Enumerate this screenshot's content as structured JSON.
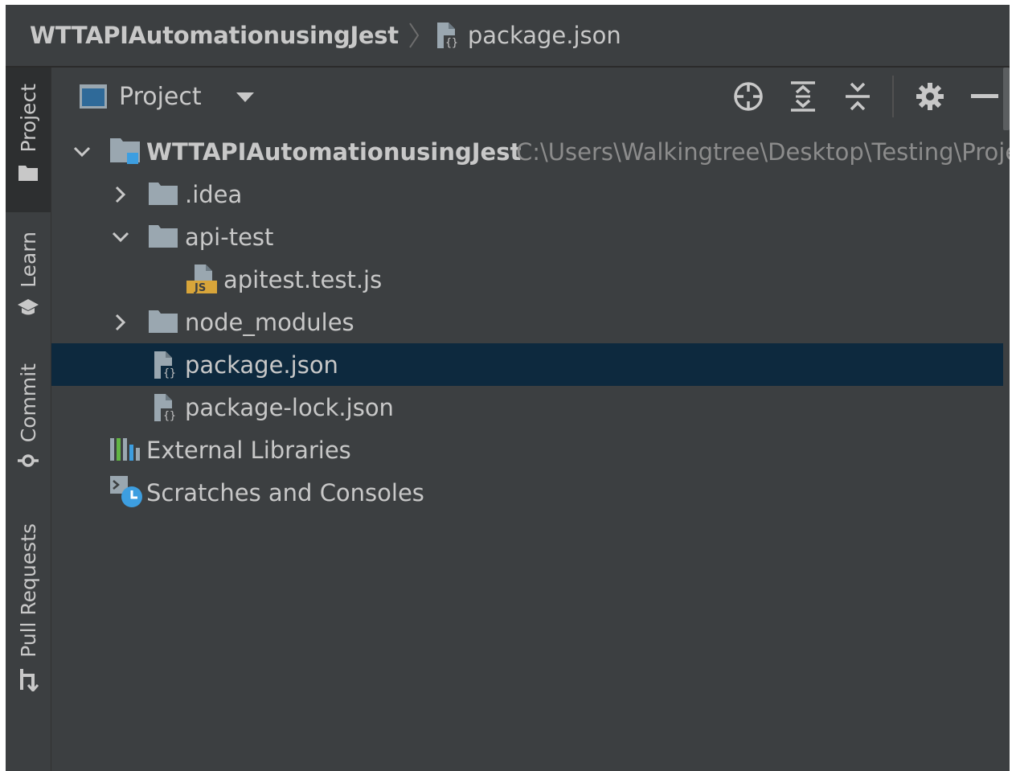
{
  "breadcrumb": {
    "project": "WTTAPIAutomationusingJest",
    "file": "package.json"
  },
  "tool_strip": {
    "tabs": [
      {
        "label": "Project",
        "icon": "folder-icon",
        "active": true
      },
      {
        "label": "Learn",
        "icon": "graduation-cap-icon",
        "active": false
      },
      {
        "label": "Commit",
        "icon": "commit-icon",
        "active": false
      },
      {
        "label": "Pull Requests",
        "icon": "pull-request-icon",
        "active": false
      }
    ]
  },
  "panel": {
    "title": "Project",
    "header_icons": [
      "locate-icon",
      "expand-all-icon",
      "collapse-all-icon",
      "settings-icon",
      "hide-icon"
    ]
  },
  "tree": {
    "items": [
      {
        "label": "WTTAPIAutomationusingJest",
        "path": "C:\\Users\\Walkingtree\\Desktop\\Testing\\Proje",
        "type": "project-folder",
        "expanded": true
      },
      {
        "label": ".idea",
        "type": "folder",
        "expanded": false
      },
      {
        "label": "api-test",
        "type": "folder",
        "expanded": true
      },
      {
        "label": "apitest.test.js",
        "type": "js-file"
      },
      {
        "label": "node_modules",
        "type": "folder",
        "expanded": false
      },
      {
        "label": "package.json",
        "type": "json-file",
        "selected": true
      },
      {
        "label": "package-lock.json",
        "type": "json-file"
      },
      {
        "label": "External Libraries",
        "type": "libraries"
      },
      {
        "label": "Scratches and Consoles",
        "type": "scratches"
      }
    ]
  },
  "colors": {
    "background": "#3c3f41",
    "selection": "#0d293e",
    "text": "#c8c8c8",
    "path_text": "#8c8c8c",
    "accent_blue": "#3d9ee0",
    "js_badge": "#d8a53a"
  }
}
